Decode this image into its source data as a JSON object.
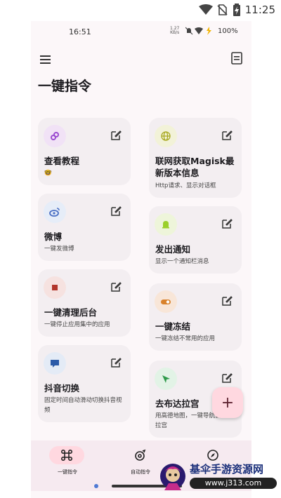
{
  "device_status": {
    "time": "11:25"
  },
  "screen_status": {
    "time": "16:51",
    "speed_value": "1.27",
    "speed_unit": "KB/s",
    "battery": "100%"
  },
  "header": {
    "title": "一键指令"
  },
  "cards": [
    {
      "title": "查看教程",
      "subtitle": "🤓"
    },
    {
      "title": "联网获取Magisk最新版本信息",
      "subtitle": "Http请求、显示对话框"
    },
    {
      "title": "微博",
      "subtitle": "一键发微博"
    },
    {
      "title": "发出通知",
      "subtitle": "显示一个通知栏消息"
    },
    {
      "title": "一键清理后台",
      "subtitle": "一键停止应用集中的应用"
    },
    {
      "title": "一键冻结",
      "subtitle": "一键冻结不常用的应用"
    },
    {
      "title": "抖音切换",
      "subtitle": "固定时间自动滑动切换抖音视频"
    },
    {
      "title": "去布达拉宫",
      "subtitle": "用高德地图，一键导航去布达拉宫"
    }
  ],
  "fab": {
    "label": "+"
  },
  "bottom_nav": [
    {
      "label": "一键指令",
      "selected": true
    },
    {
      "label": "自动指令",
      "selected": false
    },
    {
      "label": "",
      "selected": false
    }
  ],
  "watermark": {
    "title": "基伞手游资源网",
    "url": "www.j313.com"
  },
  "colors": {
    "background": "#fcf7f9",
    "card": "#f3eef1",
    "nav": "#f6eaf0",
    "fab": "#ffd8e0"
  }
}
